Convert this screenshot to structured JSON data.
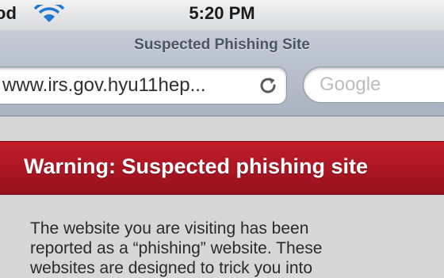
{
  "status_bar": {
    "carrier": "od",
    "time": "5:20 PM"
  },
  "navigation": {
    "page_title": "Suspected Phishing Site",
    "url": "www.irs.gov.hyu11hep...",
    "search_placeholder": "Google"
  },
  "warning": {
    "title": "Warning: Suspected phishing site",
    "lines": [
      "The website you are visiting has been",
      "reported as a “phishing” website. These",
      "websites are designed to trick you into"
    ]
  },
  "colors": {
    "banner": "#b3141f",
    "nav_bar": "#b6bfcb",
    "page_background": "#d7d7d7"
  }
}
